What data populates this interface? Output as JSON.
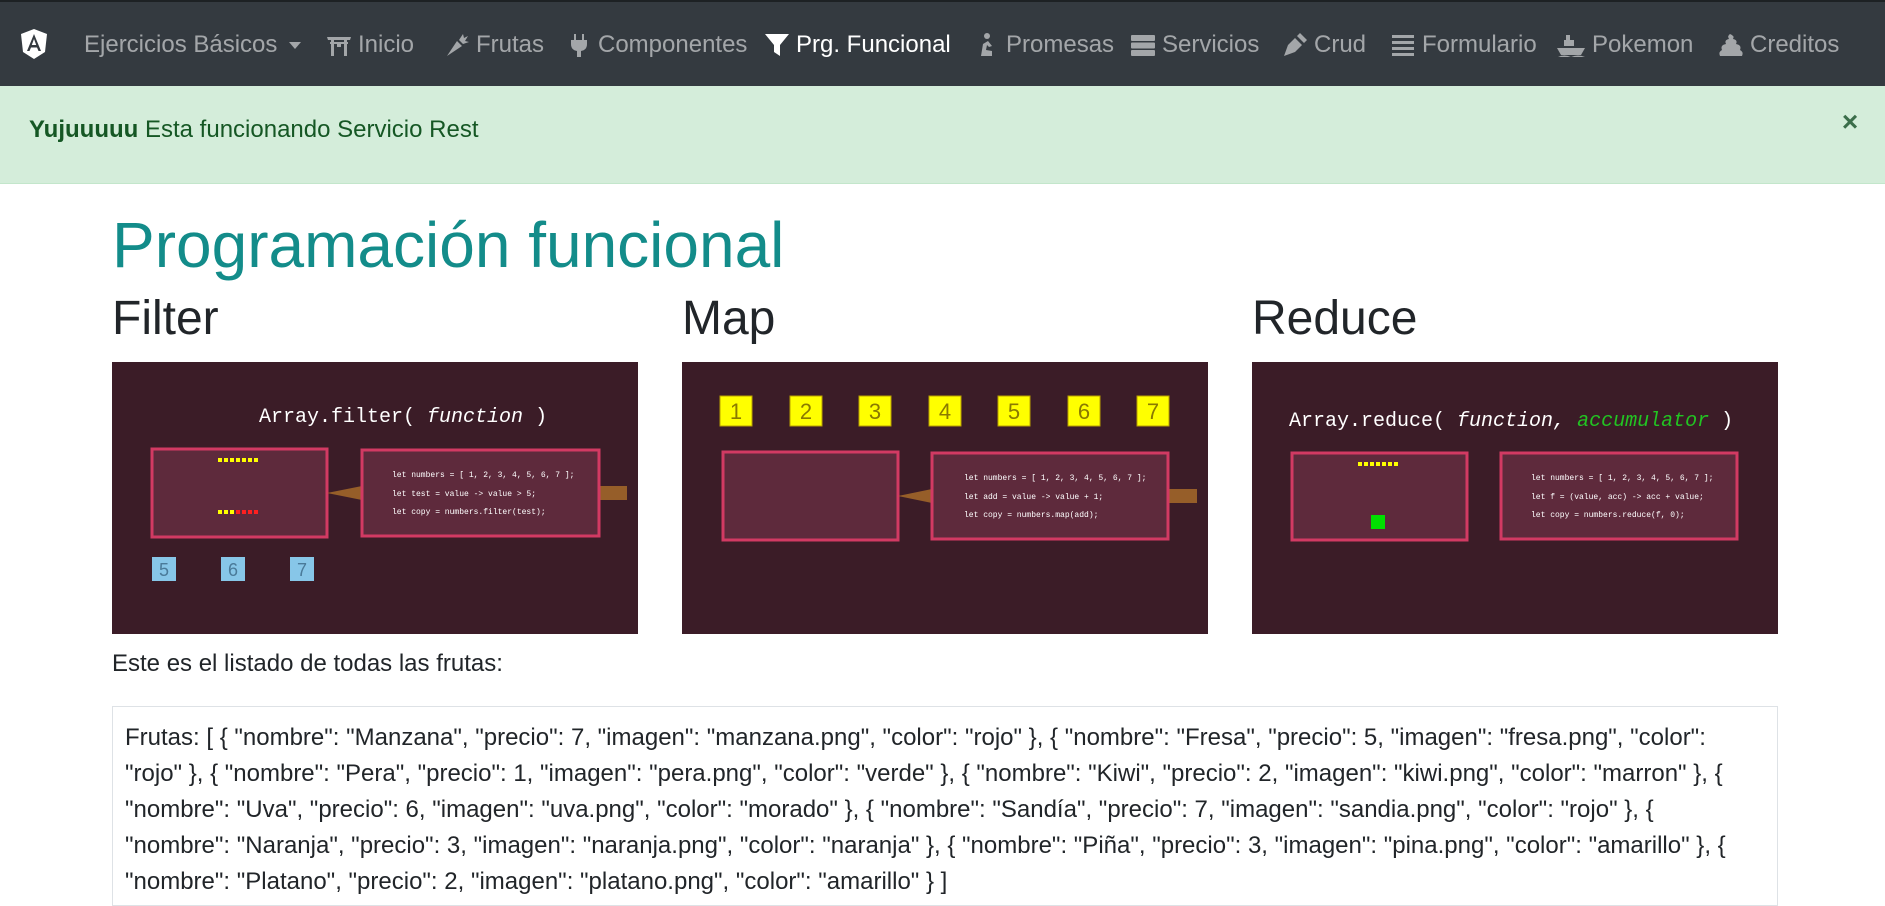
{
  "navbar": {
    "brand_icon": "angular-logo-icon",
    "items": [
      {
        "label": "Ejercicios Básicos",
        "icon": "dropdown-caret",
        "active": false
      },
      {
        "label": "Inicio",
        "icon": "torii-gate-icon",
        "active": false
      },
      {
        "label": "Frutas",
        "icon": "carrot-icon",
        "active": false
      },
      {
        "label": "Componentes",
        "icon": "plug-icon",
        "active": false
      },
      {
        "label": "Prg. Funcional",
        "icon": "filter-icon",
        "active": true
      },
      {
        "label": "Promesas",
        "icon": "praying-person-icon",
        "active": false
      },
      {
        "label": "Servicios",
        "icon": "server-icon",
        "active": false
      },
      {
        "label": "Crud",
        "icon": "pen-nib-icon",
        "active": false
      },
      {
        "label": "Formulario",
        "icon": "list-icon",
        "active": false
      },
      {
        "label": "Pokemon",
        "icon": "ship-icon",
        "active": false
      },
      {
        "label": "Creditos",
        "icon": "poop-icon",
        "active": false
      }
    ]
  },
  "alert": {
    "strong": "Yujuuuuu",
    "message": "Esta funcionando Servicio Rest",
    "close": "×"
  },
  "page": {
    "title": "Programación funcional",
    "columns": [
      {
        "title": "Filter"
      },
      {
        "title": "Map"
      },
      {
        "title": "Reduce"
      }
    ],
    "caption": "Este es el listado de todas las frutas:",
    "fruits_text": "Frutas: [ { \"nombre\": \"Manzana\", \"precio\": 7, \"imagen\": \"manzana.png\", \"color\": \"rojo\" }, { \"nombre\": \"Fresa\", \"precio\": 5, \"imagen\": \"fresa.png\", \"color\": \"rojo\" }, { \"nombre\": \"Pera\", \"precio\": 1, \"imagen\": \"pera.png\", \"color\": \"verde\" }, { \"nombre\": \"Kiwi\", \"precio\": 2, \"imagen\": \"kiwi.png\", \"color\": \"marron\" }, { \"nombre\": \"Uva\", \"precio\": 6, \"imagen\": \"uva.png\", \"color\": \"morado\" }, { \"nombre\": \"Sandía\", \"precio\": 7, \"imagen\": \"sandia.png\", \"color\": \"rojo\" }, { \"nombre\": \"Naranja\", \"precio\": 3, \"imagen\": \"naranja.png\", \"color\": \"naranja\" }, { \"nombre\": \"Piña\", \"precio\": 3, \"imagen\": \"pina.png\", \"color\": \"amarillo\" }, { \"nombre\": \"Platano\", \"precio\": 2, \"imagen\": \"platano.png\", \"color\": \"amarillo\" } ]"
  },
  "gifs": {
    "filter": {
      "heading_prefix": "Array.filter(",
      "heading_fn": "function",
      "heading_suffix": ")",
      "code": [
        "let numbers = [ 1, 2, 3, 4, 5, 6, 7 ];",
        "let test = value -> value > 5;",
        "let copy = numbers.filter(test);"
      ],
      "outputs": [
        "5",
        "6",
        "7"
      ]
    },
    "map": {
      "inputs": [
        "1",
        "2",
        "3",
        "4",
        "5",
        "6",
        "7"
      ],
      "code": [
        "let numbers = [ 1, 2, 3, 4, 5, 6, 7 ];",
        "let add = value -> value + 1;",
        "let copy = numbers.map(add);"
      ]
    },
    "reduce": {
      "heading_prefix": "Array.reduce(",
      "heading_fn": "function,",
      "heading_acc": "accumulator",
      "heading_suffix": ")",
      "code": [
        "let numbers = [ 1, 2, 3, 4, 5, 6, 7 ];",
        "let f = (value, acc) -> acc + value;",
        "let copy = numbers.reduce(f, 0);"
      ]
    }
  },
  "colors": {
    "navbar_bg": "#343a40",
    "alert_bg": "#d4edda",
    "alert_text": "#155724",
    "title": "#138c8a",
    "gif_bg": "#3b1c27",
    "gif_box_border": "#d23a63",
    "token_yellow": "#ffff00",
    "token_blue": "#87c6e8",
    "accumulator_green": "#22c322"
  }
}
